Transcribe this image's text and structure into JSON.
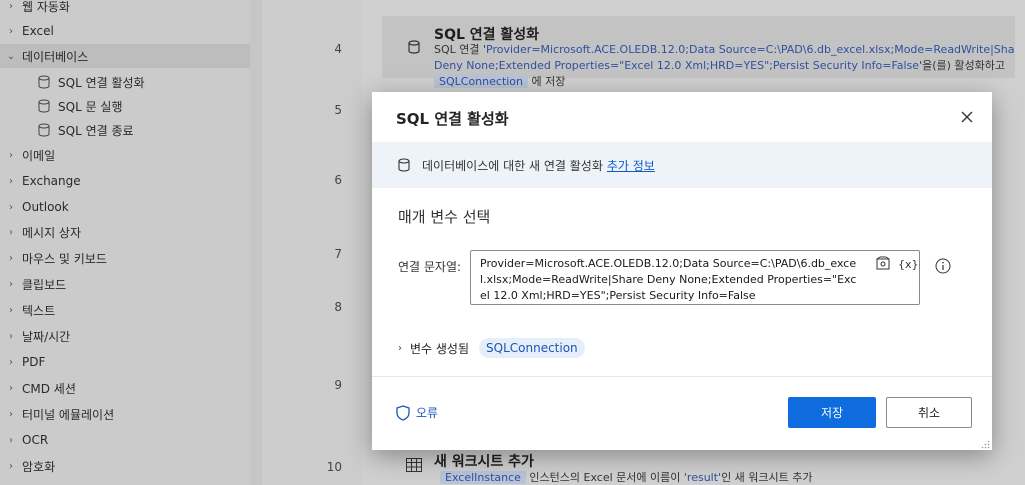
{
  "sidebar": {
    "items": [
      {
        "label": "웹 자동화",
        "expanded": false
      },
      {
        "label": "Excel",
        "expanded": false
      },
      {
        "label": "데이터베이스",
        "expanded": true,
        "children": [
          {
            "label": "SQL 연결 활성화",
            "icon": "database-icon"
          },
          {
            "label": "SQL 문 실행",
            "icon": "database-icon"
          },
          {
            "label": "SQL 연결 종료",
            "icon": "database-icon"
          }
        ]
      },
      {
        "label": "이메일",
        "expanded": false
      },
      {
        "label": "Exchange",
        "expanded": false
      },
      {
        "label": "Outlook",
        "expanded": false
      },
      {
        "label": "메시지 상자",
        "expanded": false
      },
      {
        "label": "마우스 및 키보드",
        "expanded": false
      },
      {
        "label": "클립보드",
        "expanded": false
      },
      {
        "label": "텍스트",
        "expanded": false
      },
      {
        "label": "날짜/시간",
        "expanded": false
      },
      {
        "label": "PDF",
        "expanded": false
      },
      {
        "label": "CMD 세션",
        "expanded": false
      },
      {
        "label": "터미널 에뮬레이션",
        "expanded": false
      },
      {
        "label": "OCR",
        "expanded": false
      },
      {
        "label": "암호화",
        "expanded": false
      }
    ]
  },
  "flow": {
    "line_numbers": [
      "4",
      "5",
      "6",
      "7",
      "8",
      "9",
      "10"
    ],
    "action4": {
      "title": "SQL 연결 활성화",
      "desc_prefix": "SQL 연결 '",
      "desc_connection": "Provider=Microsoft.ACE.OLEDB.12.0;Data Source=C:\\PAD\\6.db_excel.xlsx;Mode=ReadWrite|Share Deny None;Extended Properties=\"Excel 12.0 Xml;HRD=YES\";Persist Security",
      "desc_tail_token": "Info=False",
      "desc_middle": "'을(를) 활성화하고 ",
      "desc_var": "SQLConnection",
      "desc_suffix": " 에 저장"
    },
    "action10": {
      "title": "새 워크시트 추가",
      "var": "ExcelInstance",
      "desc_mid": " 인스턴스의 Excel 문서에 이름이 ",
      "desc_name": "'result'",
      "desc_suffix": "인 새 워크시트 추가"
    }
  },
  "dialog": {
    "title": "SQL 연결 활성화",
    "info_text": "데이터베이스에 대한 새 연결 활성화",
    "info_link": "추가 정보",
    "section_title": "매개 변수 선택",
    "connection_label": "연결 문자열:",
    "connection_value": "Provider=Microsoft.ACE.OLEDB.12.0;Data Source=C:\\PAD\\6.db_excel.xlsx;Mode=ReadWrite|Share Deny None;Extended Properties=\"Excel 12.0 Xml;HRD=YES\";Persist Security Info=False",
    "var_button": "{x}",
    "vars_produced_label": "변수 생성됨",
    "vars_produced_value": "SQLConnection",
    "errors_label": "오류",
    "save_label": "저장",
    "cancel_label": "취소"
  },
  "colors": {
    "primary": "#0f6cdf",
    "link": "#1b56b8",
    "info_bg": "#eef3fa",
    "var_pill_bg": "#e6eef9"
  }
}
